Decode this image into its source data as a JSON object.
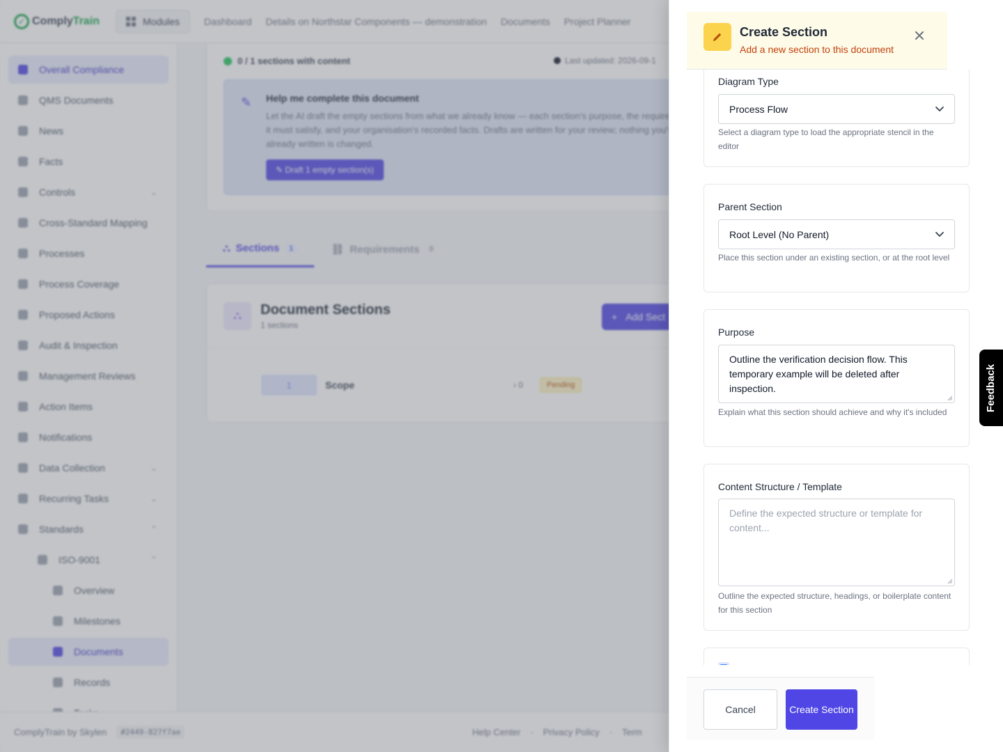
{
  "app": {
    "logo_prefix": "Comply",
    "logo_suffix": "Train",
    "modules_label": "Modules",
    "nav": [
      "Dashboard",
      "Details on Northstar Components — demonstration",
      "Documents",
      "Project Planner"
    ]
  },
  "sidebar": {
    "items": [
      {
        "label": "Overall Compliance",
        "active": true
      },
      {
        "label": "QMS Documents"
      },
      {
        "label": "News"
      },
      {
        "label": "Facts"
      },
      {
        "label": "Controls",
        "chevron": "⌄"
      },
      {
        "label": "Cross-Standard Mapping"
      },
      {
        "label": "Processes"
      },
      {
        "label": "Process Coverage"
      },
      {
        "label": "Proposed Actions"
      },
      {
        "label": "Audit & Inspection"
      },
      {
        "label": "Management Reviews"
      },
      {
        "label": "Action Items"
      },
      {
        "label": "Notifications"
      },
      {
        "label": "Data Collection",
        "chevron": "⌄"
      },
      {
        "label": "Recurring Tasks",
        "chevron": "⌄"
      },
      {
        "label": "Standards",
        "chevron": "⌃"
      },
      {
        "label": "ISO-9001",
        "chevron": "⌃",
        "level": 1
      },
      {
        "label": "Overview",
        "level": 2
      },
      {
        "label": "Milestones",
        "level": 2
      },
      {
        "label": "Documents",
        "level": 2,
        "active": true
      },
      {
        "label": "Records",
        "level": 2
      },
      {
        "label": "Tasks",
        "level": 2
      }
    ]
  },
  "main": {
    "status": "0 / 1 sections with content",
    "last_updated": "Last updated: 2026-09-1",
    "ai": {
      "title": "Help me complete this document",
      "body": "Let the AI draft the empty sections from what we already know — each section's purpose, the requirements it must satisfy, and your organisation's recorded facts. Drafts are written for your review; nothing you've already written is changed.",
      "button": "Draft 1 empty section(s)"
    },
    "tabs": [
      {
        "label": "Sections",
        "count": "1",
        "active": true
      },
      {
        "label": "Requirements",
        "count": "0"
      }
    ],
    "sections_card": {
      "title": "Document Sections",
      "count": "1 sections",
      "add_button": "Add Sect",
      "rows": [
        {
          "number": "1",
          "name": "Scope",
          "children": "› 0",
          "status": "Pending"
        }
      ]
    }
  },
  "footer": {
    "brand": "ComplyTrain by Skylen",
    "build": "#2449-827f7ae",
    "links": [
      "Help Center",
      "·",
      "Privacy Policy",
      "·",
      "Term"
    ]
  },
  "drawer": {
    "title": "Create Section",
    "subtitle": "Add a new section to this document",
    "diagram_type": {
      "label": "Diagram Type",
      "value": "Process Flow",
      "help": "Select a diagram type to load the appropriate stencil in the editor"
    },
    "parent_section": {
      "label": "Parent Section",
      "value": "Root Level (No Parent)",
      "help": "Place this section under an existing section, or at the root level"
    },
    "purpose": {
      "label": "Purpose",
      "value": "Outline the verification decision flow. This temporary example will be deleted after inspection.",
      "help": "Explain what this section should achieve and why it's included"
    },
    "content_structure": {
      "label": "Content Structure / Template",
      "placeholder": "Define the expected structure or template for content...",
      "help": "Outline the expected structure, headings, or boilerplate content for this section"
    },
    "cancel_label": "Cancel",
    "create_label": "Create Section"
  },
  "feedback_label": "Feedback",
  "colors": {
    "accent": "#4f46e5",
    "header_bg": "#fefbe8",
    "header_icon": "#fcd34d",
    "subtitle": "#c2410c"
  }
}
